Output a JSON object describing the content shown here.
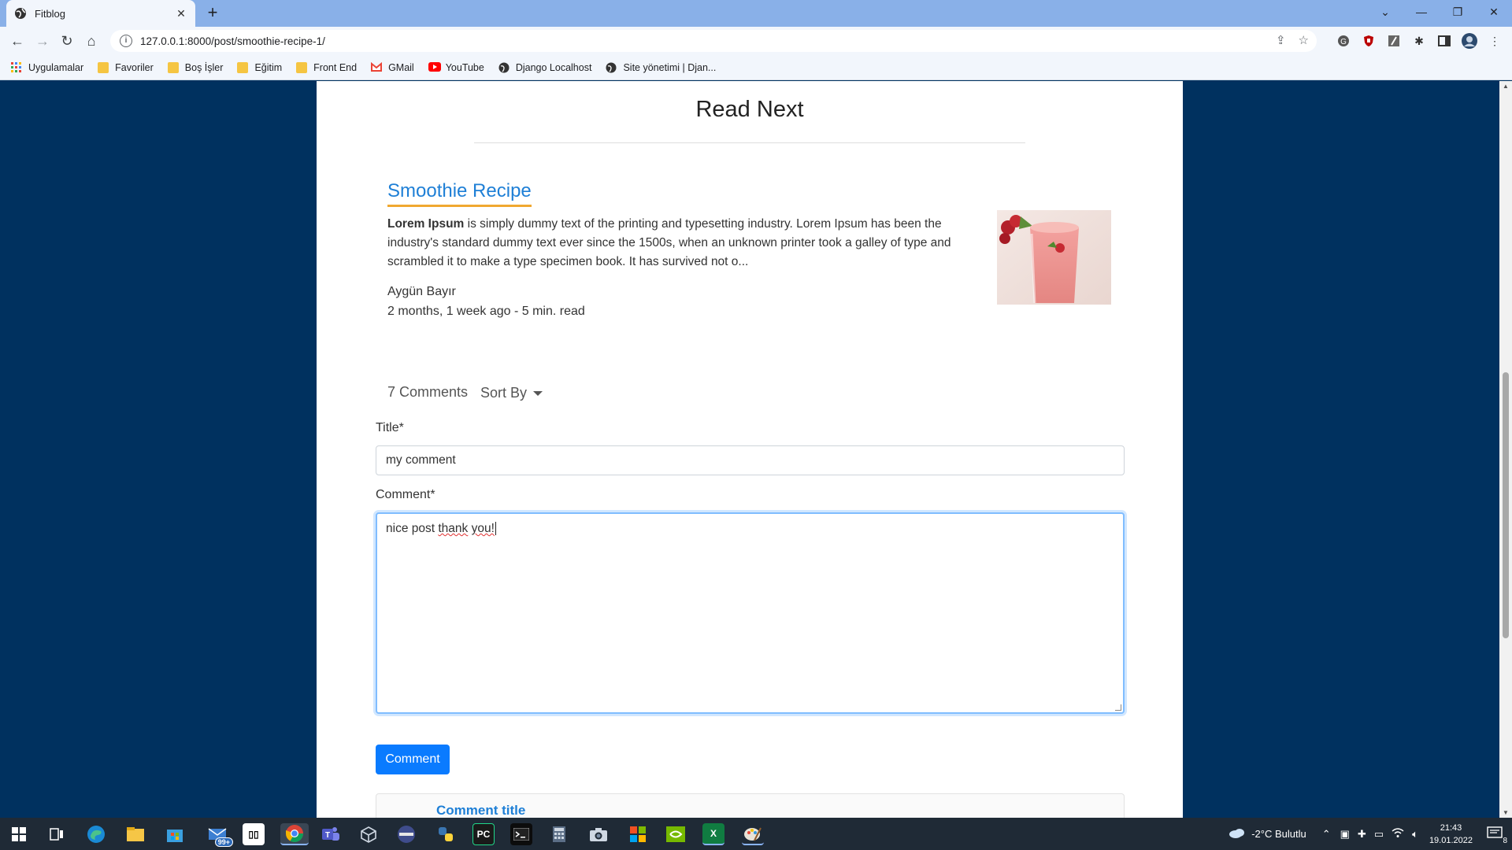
{
  "browser": {
    "tab_title": "Fitblog",
    "tab_close": "✕",
    "new_tab": "+",
    "url": "127.0.0.1:8000/post/smoothie-recipe-1/",
    "window_controls": {
      "tabsearch": "⌄",
      "minimize": "—",
      "restore": "❐",
      "close": "✕"
    },
    "nav": {
      "back": "←",
      "forward": "→",
      "reload": "↻",
      "home": "⌂"
    },
    "bookmarks": [
      {
        "label": "Uygulamalar",
        "icon": "apps-grid-icon"
      },
      {
        "label": "Favoriler",
        "icon": "folder-icon"
      },
      {
        "label": "Boş İşler",
        "icon": "folder-icon"
      },
      {
        "label": "Eğitim",
        "icon": "folder-icon"
      },
      {
        "label": "Front End",
        "icon": "folder-icon"
      },
      {
        "label": "GMail",
        "icon": "gmail-icon"
      },
      {
        "label": "YouTube",
        "icon": "youtube-icon"
      },
      {
        "label": "Django Localhost",
        "icon": "globe-icon"
      },
      {
        "label": "Site yönetimi | Djan...",
        "icon": "globe-icon"
      }
    ]
  },
  "page": {
    "read_next": "Read Next",
    "post": {
      "title": "Smoothie Recipe",
      "excerpt_bold": "Lorem Ipsum",
      "excerpt_rest": " is simply dummy text of the printing and typesetting industry. Lorem Ipsum has been the industry's standard dummy text ever since the 1500s, when an unknown printer took a galley of type and scrambled it to make a type specimen book. It has survived not o...",
      "author": "Aygün Bayır",
      "meta": "2 months, 1 week ago - 5 min. read"
    },
    "comments": {
      "count": "7 Comments",
      "sort_by": "Sort By",
      "title_label": "Title*",
      "title_value": "my comment",
      "comment_label": "Comment*",
      "comment_value_plain": "nice post ",
      "comment_value_flag1": "thank",
      "comment_value_space": " ",
      "comment_value_flag2": "you!",
      "submit": "Comment",
      "first_comment_title": "Comment title"
    }
  },
  "taskbar": {
    "weather": "-2°C  Bulutlu",
    "time": "21:43",
    "date": "19.01.2022",
    "notifications": "8",
    "mail_badge": "99+"
  },
  "colors": {
    "page_background": "#00315f",
    "link": "#1e7fd6",
    "title_underline": "#f0a830",
    "button": "#0a7bff",
    "tab_strip": "#89b0e8"
  }
}
